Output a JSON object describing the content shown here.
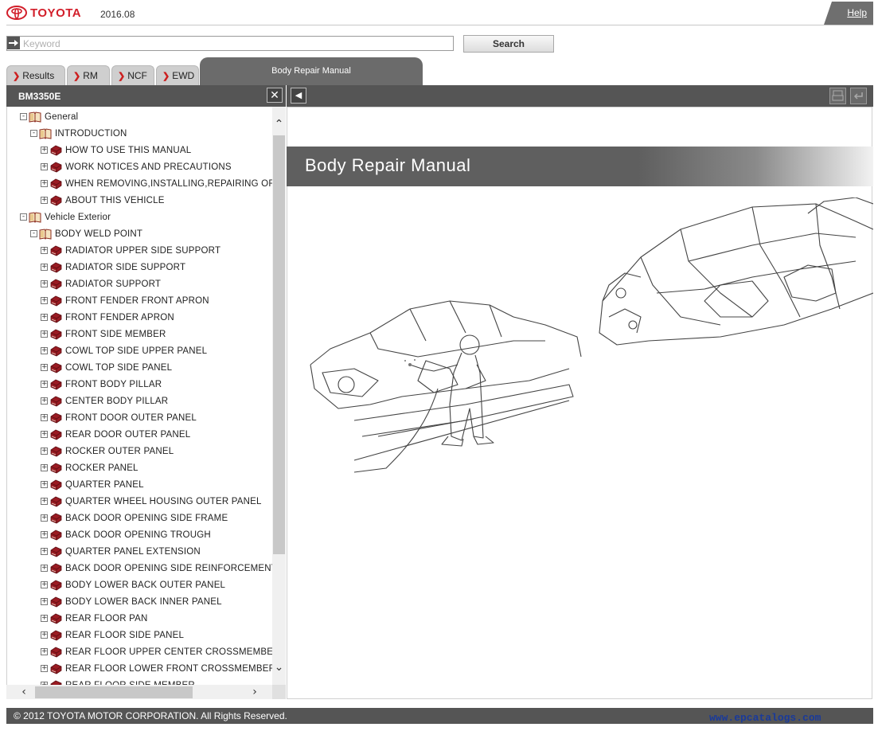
{
  "header": {
    "brand": "TOYOTA",
    "version": "2016.08",
    "help_label": "Help"
  },
  "search": {
    "placeholder": "Keyword",
    "value": "",
    "button_label": "Search"
  },
  "tabs": [
    {
      "label": "Results"
    },
    {
      "label": "RM"
    },
    {
      "label": "NCF"
    },
    {
      "label": "EWD"
    }
  ],
  "active_tab": {
    "label": "Body Repair Manual"
  },
  "left_panel": {
    "title": "BM3350E",
    "tree": [
      {
        "label": "General",
        "level": 0,
        "state": "-",
        "icon": "open-book-icon"
      },
      {
        "label": "INTRODUCTION",
        "level": 1,
        "state": "-",
        "icon": "open-book-icon"
      },
      {
        "label": "HOW TO USE THIS MANUAL",
        "level": 2,
        "state": "+",
        "icon": "closed-book-icon"
      },
      {
        "label": "WORK NOTICES AND PRECAUTIONS",
        "level": 2,
        "state": "+",
        "icon": "closed-book-icon"
      },
      {
        "label": "WHEN REMOVING,INSTALLING,REPAIRING OR",
        "level": 2,
        "state": "+",
        "icon": "closed-book-icon"
      },
      {
        "label": "ABOUT THIS VEHICLE",
        "level": 2,
        "state": "+",
        "icon": "closed-book-icon"
      },
      {
        "label": "Vehicle Exterior",
        "level": 0,
        "state": "-",
        "icon": "open-book-icon"
      },
      {
        "label": "BODY WELD POINT",
        "level": 1,
        "state": "-",
        "icon": "open-book-icon"
      },
      {
        "label": "RADIATOR UPPER SIDE SUPPORT",
        "level": 2,
        "state": "+",
        "icon": "closed-book-icon"
      },
      {
        "label": "RADIATOR SIDE SUPPORT",
        "level": 2,
        "state": "+",
        "icon": "closed-book-icon"
      },
      {
        "label": "RADIATOR SUPPORT",
        "level": 2,
        "state": "+",
        "icon": "closed-book-icon"
      },
      {
        "label": "FRONT FENDER FRONT APRON",
        "level": 2,
        "state": "+",
        "icon": "closed-book-icon"
      },
      {
        "label": "FRONT FENDER APRON",
        "level": 2,
        "state": "+",
        "icon": "closed-book-icon"
      },
      {
        "label": "FRONT SIDE MEMBER",
        "level": 2,
        "state": "+",
        "icon": "closed-book-icon"
      },
      {
        "label": "COWL TOP SIDE UPPER PANEL",
        "level": 2,
        "state": "+",
        "icon": "closed-book-icon"
      },
      {
        "label": "COWL TOP SIDE PANEL",
        "level": 2,
        "state": "+",
        "icon": "closed-book-icon"
      },
      {
        "label": "FRONT BODY PILLAR",
        "level": 2,
        "state": "+",
        "icon": "closed-book-icon"
      },
      {
        "label": "CENTER BODY PILLAR",
        "level": 2,
        "state": "+",
        "icon": "closed-book-icon"
      },
      {
        "label": "FRONT DOOR OUTER PANEL",
        "level": 2,
        "state": "+",
        "icon": "closed-book-icon"
      },
      {
        "label": "REAR DOOR OUTER PANEL",
        "level": 2,
        "state": "+",
        "icon": "closed-book-icon"
      },
      {
        "label": "ROCKER OUTER PANEL",
        "level": 2,
        "state": "+",
        "icon": "closed-book-icon"
      },
      {
        "label": "ROCKER PANEL",
        "level": 2,
        "state": "+",
        "icon": "closed-book-icon"
      },
      {
        "label": "QUARTER PANEL",
        "level": 2,
        "state": "+",
        "icon": "closed-book-icon"
      },
      {
        "label": "QUARTER WHEEL HOUSING OUTER PANEL",
        "level": 2,
        "state": "+",
        "icon": "closed-book-icon"
      },
      {
        "label": "BACK DOOR OPENING SIDE FRAME",
        "level": 2,
        "state": "+",
        "icon": "closed-book-icon"
      },
      {
        "label": "BACK DOOR OPENING TROUGH",
        "level": 2,
        "state": "+",
        "icon": "closed-book-icon"
      },
      {
        "label": "QUARTER PANEL EXTENSION",
        "level": 2,
        "state": "+",
        "icon": "closed-book-icon"
      },
      {
        "label": "BACK DOOR OPENING SIDE REINFORCEMENT",
        "level": 2,
        "state": "+",
        "icon": "closed-book-icon"
      },
      {
        "label": "BODY LOWER BACK OUTER PANEL",
        "level": 2,
        "state": "+",
        "icon": "closed-book-icon"
      },
      {
        "label": "BODY LOWER BACK INNER PANEL",
        "level": 2,
        "state": "+",
        "icon": "closed-book-icon"
      },
      {
        "label": "REAR FLOOR PAN",
        "level": 2,
        "state": "+",
        "icon": "closed-book-icon"
      },
      {
        "label": "REAR FLOOR SIDE PANEL",
        "level": 2,
        "state": "+",
        "icon": "closed-book-icon"
      },
      {
        "label": "REAR FLOOR UPPER CENTER CROSSMEMBER",
        "level": 2,
        "state": "+",
        "icon": "closed-book-icon"
      },
      {
        "label": "REAR FLOOR LOWER FRONT CROSSMEMBER",
        "level": 2,
        "state": "+",
        "icon": "closed-book-icon"
      },
      {
        "label": "REAR FLOOR SIDE MEMBER",
        "level": 2,
        "state": "+",
        "icon": "closed-book-icon"
      }
    ]
  },
  "content": {
    "banner_title": "Body Repair Manual"
  },
  "footer": {
    "copyright": "© 2012 TOYOTA MOTOR CORPORATION. All Rights Reserved.",
    "watermark": "www.epcatalogs.com"
  },
  "colors": {
    "brand_red": "#d21e2a",
    "toolbar_gray": "#555555",
    "tab_active": "#6b6b6b",
    "book_red": "#9a1b22",
    "watermark_blue": "#1a3a9a"
  }
}
